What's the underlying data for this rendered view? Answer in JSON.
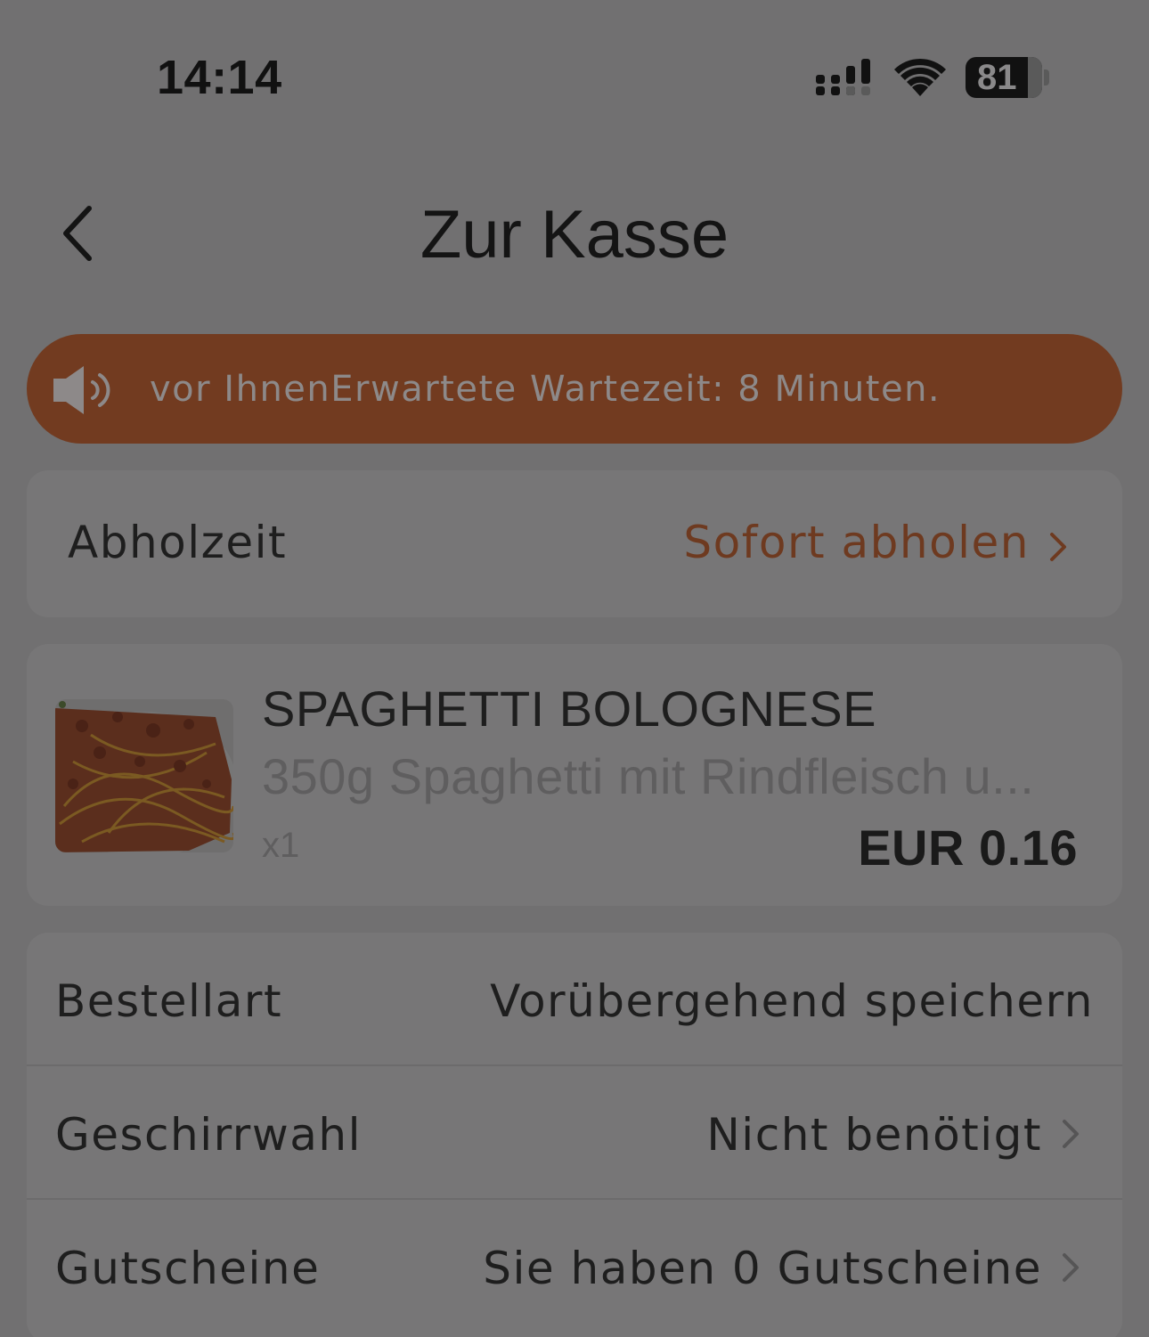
{
  "status_bar": {
    "time": "14:14",
    "battery": "81",
    "battery_level": 0.81,
    "icons": [
      "signal-icon",
      "wifi-icon",
      "battery-icon"
    ]
  },
  "nav": {
    "title": "Zur Kasse",
    "back_icon": "chevron-left-icon"
  },
  "notice": {
    "text": "vor IhnenErwartete Wartezeit: 8 Minuten.",
    "icon": "speaker-icon"
  },
  "pickup": {
    "label": "Abholzeit",
    "value": "Sofort abholen"
  },
  "product": {
    "name": "SPAGHETTI BOLOGNESE",
    "description": "350g Spaghetti mit Rindfleisch u...",
    "quantity": "x1",
    "price": "EUR 0.16"
  },
  "options": {
    "order_type": {
      "label": "Bestellart",
      "value": "Vorübergehend speichern"
    },
    "tableware": {
      "label": "Geschirrwahl",
      "value": "Nicht benötigt"
    },
    "vouchers": {
      "label": "Gutscheine",
      "value": "Sie haben 0 Gutscheine"
    }
  },
  "colors": {
    "overlay_background": "#717071",
    "notice_background": "#723b20",
    "accent": "#6e3a20",
    "card_background": "#777677"
  }
}
